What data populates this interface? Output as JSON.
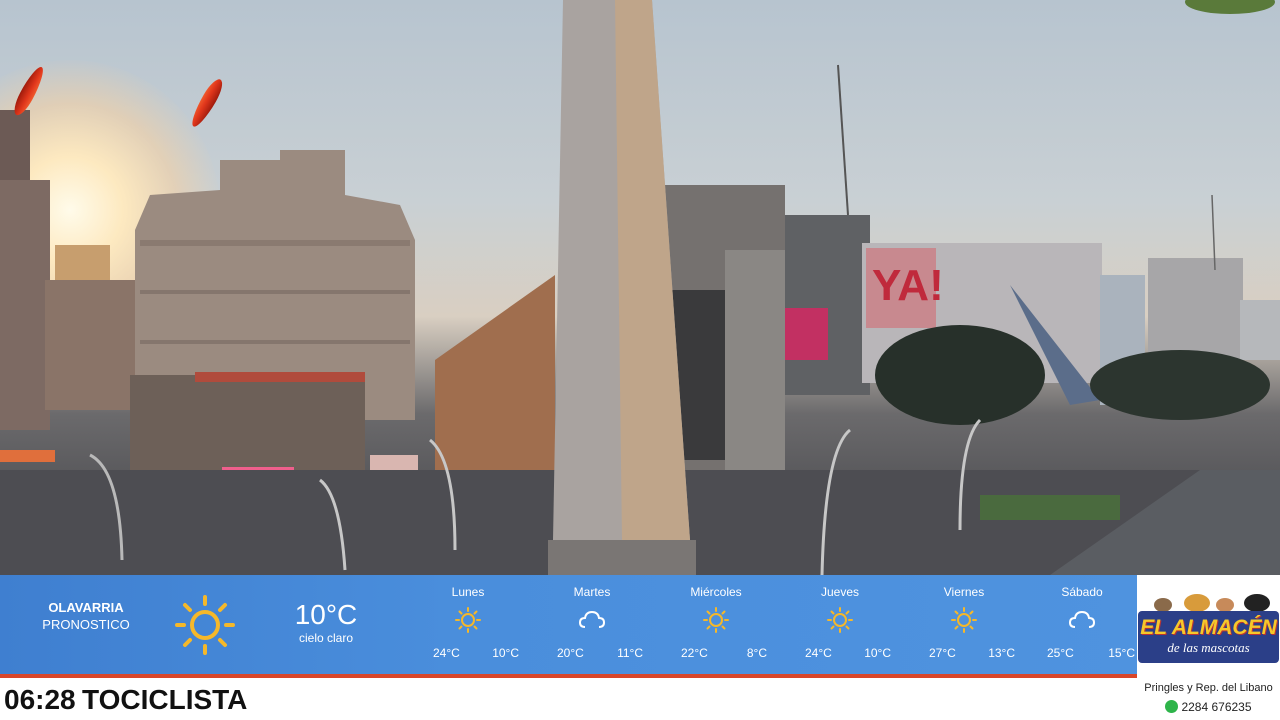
{
  "weather": {
    "location": "OLAVARRIA",
    "label": "PRONOSTICO",
    "current_temp": "10°C",
    "current_condition": "cielo claro",
    "current_icon": "sun-icon",
    "days": [
      {
        "name": "Lunes",
        "icon": "sun-icon",
        "max": "24°C",
        "min": "10°C"
      },
      {
        "name": "Martes",
        "icon": "cloud-icon",
        "max": "20°C",
        "min": "11°C"
      },
      {
        "name": "Miércoles",
        "icon": "sun-icon",
        "max": "22°C",
        "min": "8°C"
      },
      {
        "name": "Jueves",
        "icon": "sun-icon",
        "max": "24°C",
        "min": "10°C"
      },
      {
        "name": "Viernes",
        "icon": "sun-icon",
        "max": "27°C",
        "min": "13°C"
      },
      {
        "name": "Sábado",
        "icon": "cloud-icon",
        "max": "25°C",
        "min": "15°C"
      }
    ]
  },
  "ticker": {
    "time": "06:28",
    "text": "TOCICLISTA"
  },
  "sponsor": {
    "name_line1": "EL ALMACÉN",
    "name_line2": "de las mascotas",
    "address": "Pringles y Rep. del Libano",
    "phone": "2284 676235"
  },
  "colors": {
    "weather_bar": "#4a8edc",
    "ticker_accent": "#d8462a",
    "sun_icon": "#f5b82a",
    "sponsor_logo_bg": "#2b3f88"
  }
}
